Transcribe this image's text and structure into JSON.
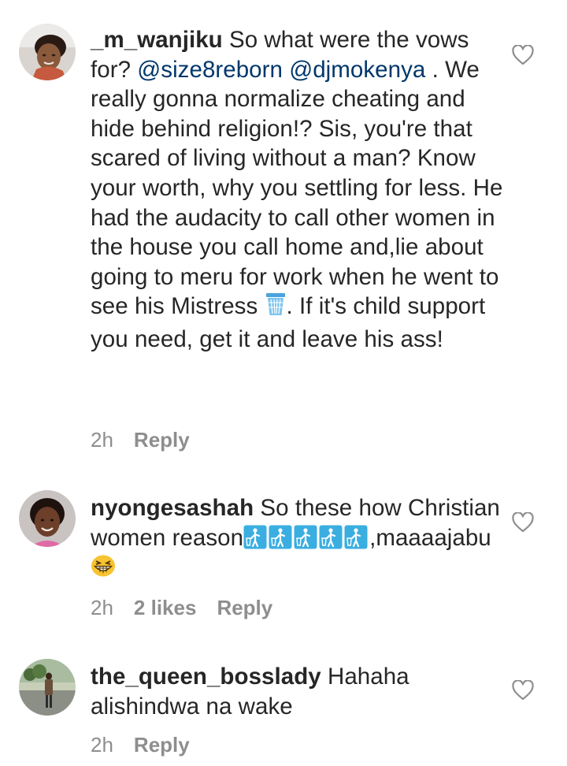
{
  "comments": [
    {
      "username": "_m_wanjiku",
      "text_before": "So what were the vows for? ",
      "mentions": [
        "@size8reborn",
        "@djmokenya"
      ],
      "text_main": " . We really gonna normalize cheating and hide behind religion!? Sis, you're that scared of living without a man? Know your worth, why you settling for less. He had the audacity to call other women in the house you call home and,lie about going to meru for work when he went to see his Mistress ",
      "text_after": ". If it's child support you need, get it and leave his ass!",
      "emoji": "wastebasket-icon",
      "time": "2h",
      "reply_label": "Reply"
    },
    {
      "username": "nyongesashah",
      "text_before": "So these how Christian women reason",
      "text_after": ",maaaajabu",
      "emoji": "litter-in-bin-icon",
      "emoji_count": 5,
      "end_emoji": "grinning-squinting-face-icon",
      "time": "2h",
      "likes": "2 likes",
      "reply_label": "Reply"
    },
    {
      "username": "the_queen_bosslady",
      "text": "Hahaha alishindwa na wake",
      "time": "2h",
      "reply_label": "Reply"
    }
  ],
  "colors": {
    "text": "#262626",
    "meta": "#8e8e8e",
    "mention": "#00376b",
    "emoji_box": "#3aaee0"
  }
}
